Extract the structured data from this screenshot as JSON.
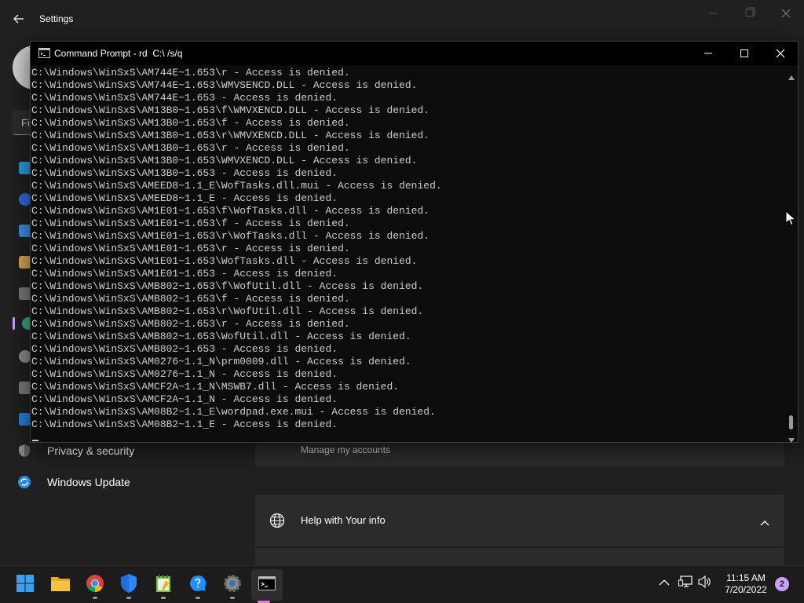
{
  "settings": {
    "title": "Settings",
    "search_prefix": "Fi",
    "nav": {
      "privacy_label": "Privacy & security",
      "update_label": "Windows Update"
    },
    "accounts_card": {
      "text": "Manage my accounts"
    },
    "help_card": {
      "text": "Help with Your info"
    }
  },
  "cmd": {
    "title": "Command Prompt - rd  C:\\ /s/q",
    "lines": [
      "C:\\Windows\\WinSxS\\AM744E~1.653\\r - Access is denied.",
      "C:\\Windows\\WinSxS\\AM744E~1.653\\WMVSENCD.DLL - Access is denied.",
      "C:\\Windows\\WinSxS\\AM744E~1.653 - Access is denied.",
      "C:\\Windows\\WinSxS\\AM13B0~1.653\\f\\WMVXENCD.DLL - Access is denied.",
      "C:\\Windows\\WinSxS\\AM13B0~1.653\\f - Access is denied.",
      "C:\\Windows\\WinSxS\\AM13B0~1.653\\r\\WMVXENCD.DLL - Access is denied.",
      "C:\\Windows\\WinSxS\\AM13B0~1.653\\r - Access is denied.",
      "C:\\Windows\\WinSxS\\AM13B0~1.653\\WMVXENCD.DLL - Access is denied.",
      "C:\\Windows\\WinSxS\\AM13B0~1.653 - Access is denied.",
      "C:\\Windows\\WinSxS\\AMEED8~1.1_E\\WofTasks.dll.mui - Access is denied.",
      "C:\\Windows\\WinSxS\\AMEED8~1.1_E - Access is denied.",
      "C:\\Windows\\WinSxS\\AM1E01~1.653\\f\\WofTasks.dll - Access is denied.",
      "C:\\Windows\\WinSxS\\AM1E01~1.653\\f - Access is denied.",
      "C:\\Windows\\WinSxS\\AM1E01~1.653\\r\\WofTasks.dll - Access is denied.",
      "C:\\Windows\\WinSxS\\AM1E01~1.653\\r - Access is denied.",
      "C:\\Windows\\WinSxS\\AM1E01~1.653\\WofTasks.dll - Access is denied.",
      "C:\\Windows\\WinSxS\\AM1E01~1.653 - Access is denied.",
      "C:\\Windows\\WinSxS\\AMB802~1.653\\f\\WofUtil.dll - Access is denied.",
      "C:\\Windows\\WinSxS\\AMB802~1.653\\f - Access is denied.",
      "C:\\Windows\\WinSxS\\AMB802~1.653\\r\\WofUtil.dll - Access is denied.",
      "C:\\Windows\\WinSxS\\AMB802~1.653\\r - Access is denied.",
      "C:\\Windows\\WinSxS\\AMB802~1.653\\WofUtil.dll - Access is denied.",
      "C:\\Windows\\WinSxS\\AMB802~1.653 - Access is denied.",
      "C:\\Windows\\WinSxS\\AM0276~1.1_N\\prm0009.dll - Access is denied.",
      "C:\\Windows\\WinSxS\\AM0276~1.1_N - Access is denied.",
      "C:\\Windows\\WinSxS\\AMCF2A~1.1_N\\MSWB7.dll - Access is denied.",
      "C:\\Windows\\WinSxS\\AMCF2A~1.1_N - Access is denied.",
      "C:\\Windows\\WinSxS\\AM08B2~1.1_E\\wordpad.exe.mui - Access is denied.",
      "C:\\Windows\\WinSxS\\AM08B2~1.1_E - Access is denied."
    ]
  },
  "taskbar": {
    "apps": [
      "start-icon",
      "file-explorer-icon",
      "chrome-icon",
      "defender-icon",
      "notepad-icon",
      "get-help-icon",
      "settings-icon",
      "command-prompt-icon"
    ],
    "clock": {
      "time": "11:15 AM",
      "date": "7/20/2022"
    },
    "notification_count": "2"
  },
  "colors": {
    "accent": "#c8a2ff",
    "console_bg": "#0c0c0c",
    "console_text": "#cccccc",
    "settings_bg": "#202020"
  }
}
